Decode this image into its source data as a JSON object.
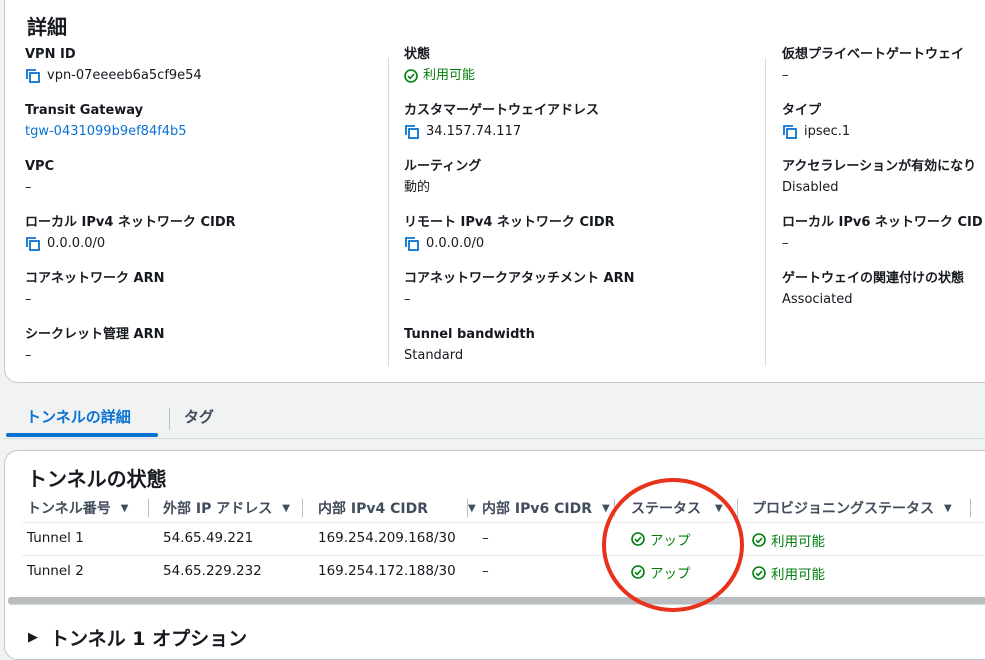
{
  "details": {
    "title": "詳細",
    "col1": [
      {
        "label": "VPN ID",
        "value": "vpn-07eeeeb6a5cf9e54",
        "icon": "copy-icon"
      },
      {
        "label": "Transit Gateway",
        "value": "tgw-0431099b9ef84f4b5",
        "link": true
      },
      {
        "label": "VPC",
        "value": "–"
      },
      {
        "label": "ローカル IPv4 ネットワーク CIDR",
        "value": "0.0.0.0/0",
        "icon": "copy-icon"
      },
      {
        "label": "コアネットワーク ARN",
        "value": "–"
      },
      {
        "label": "シークレット管理 ARN",
        "value": "–"
      }
    ],
    "col2": [
      {
        "label": "状態",
        "value": "利用可能",
        "icon": "check-circle-icon"
      },
      {
        "label": "カスタマーゲートウェイアドレス",
        "value": "34.157.74.117",
        "icon": "copy-icon"
      },
      {
        "label": "ルーティング",
        "value": "動的"
      },
      {
        "label": "リモート IPv4 ネットワーク CIDR",
        "value": "0.0.0.0/0",
        "icon": "copy-icon"
      },
      {
        "label": "コアネットワークアタッチメント ARN",
        "value": "–"
      },
      {
        "label": "Tunnel bandwidth",
        "value": "Standard"
      }
    ],
    "col3": [
      {
        "label": "仮想プライベートゲートウェイ",
        "value": "–"
      },
      {
        "label": "タイプ",
        "value": "ipsec.1",
        "icon": "copy-icon"
      },
      {
        "label": "アクセラレーションが有効になり",
        "value": "Disabled"
      },
      {
        "label": "ローカル IPv6 ネットワーク CID",
        "value": "–"
      },
      {
        "label": "ゲートウェイの関連付けの状態",
        "value": "Associated"
      }
    ]
  },
  "tabs": {
    "active": "トンネルの詳細",
    "inactive": "タグ"
  },
  "tunnels": {
    "title": "トンネルの状態",
    "columns": [
      "トンネル番号",
      "外部 IP アドレス",
      "内部 IPv4 CIDR",
      "内部 IPv6 CIDR",
      "ステータス",
      "プロビジョニングステータス"
    ],
    "rows": [
      [
        "Tunnel 1",
        "54.65.49.221",
        "169.254.209.168/30",
        "–",
        "アップ",
        "利用可能"
      ],
      [
        "Tunnel 2",
        "54.65.229.232",
        "169.254.172.188/30",
        "–",
        "アップ",
        "利用可能"
      ]
    ]
  },
  "expander": {
    "label": "トンネル 1 オプション"
  },
  "colors": {
    "link": "#0972d3",
    "success": "#037f0c",
    "annotation": "#e8321c"
  }
}
